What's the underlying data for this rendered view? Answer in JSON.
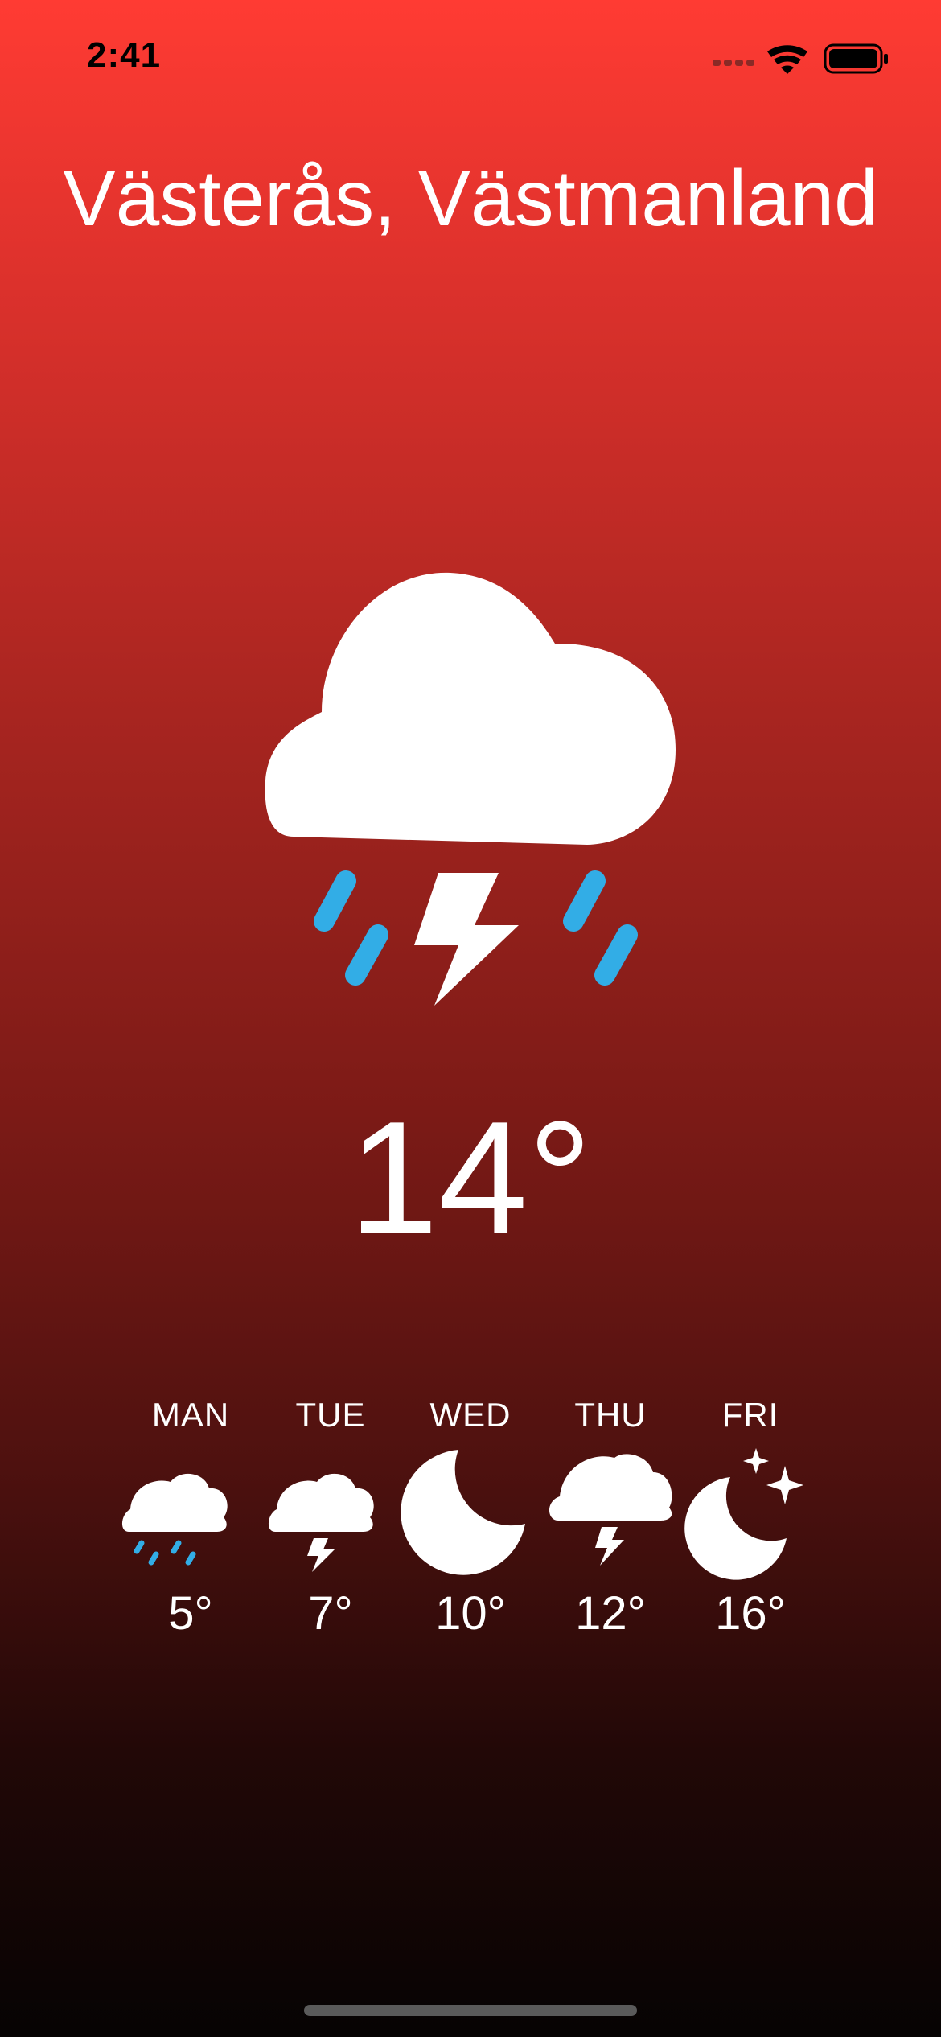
{
  "status_bar": {
    "time": "2:41"
  },
  "location": "Västerås, Västmanland",
  "current": {
    "temperature": "14°",
    "condition_icon": "cloud-bolt-rain-icon"
  },
  "forecast": [
    {
      "day": "MAN",
      "temperature": "5°",
      "icon": "cloud-moon-rain-icon"
    },
    {
      "day": "TUE",
      "temperature": "7°",
      "icon": "cloud-moon-bolt-icon"
    },
    {
      "day": "WED",
      "temperature": "10°",
      "icon": "moon-icon"
    },
    {
      "day": "THU",
      "temperature": "12°",
      "icon": "cloud-bolt-icon"
    },
    {
      "day": "FRI",
      "temperature": "16°",
      "icon": "moon-stars-icon"
    }
  ],
  "colors": {
    "gradient_top": "#ff3b33",
    "gradient_bottom": "#060303",
    "rain": "#32ade6"
  }
}
